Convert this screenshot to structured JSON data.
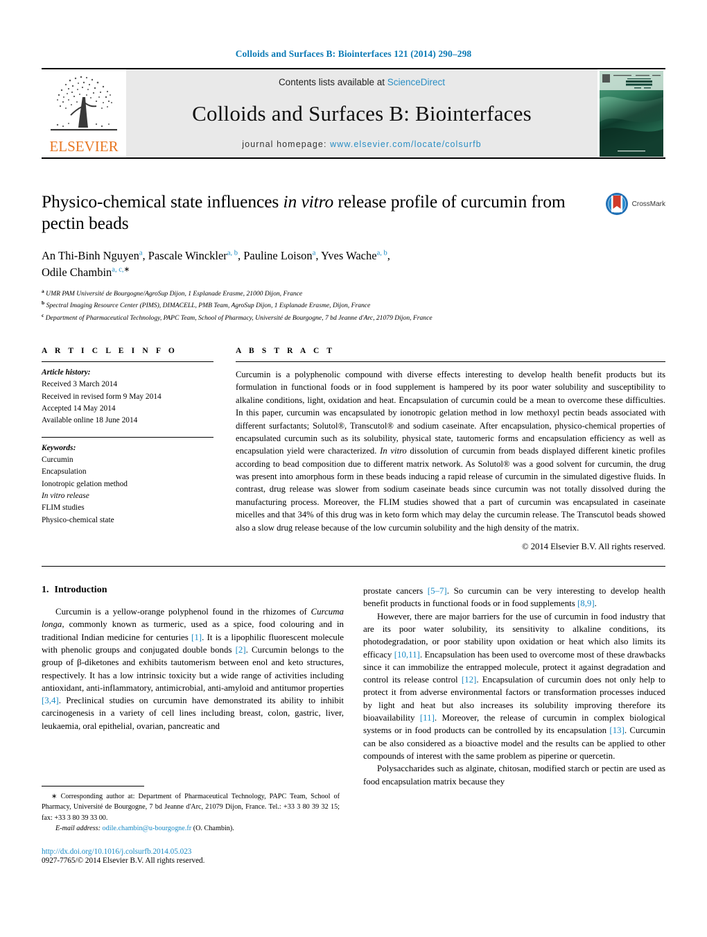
{
  "running_head": "Colloids and Surfaces B: Biointerfaces 121 (2014) 290–298",
  "masthead": {
    "contents_prefix": "Contents lists available at ",
    "sciencedirect": "ScienceDirect",
    "journal_title": "Colloids and Surfaces B: Biointerfaces",
    "homepage_label": "journal homepage: ",
    "homepage_url": "www.elsevier.com/locate/colsurfb",
    "publisher_wordmark": "ELSEVIER",
    "publisher_color": "#E87722",
    "cover_alt": "journal-cover-thumbnail"
  },
  "article": {
    "title_part1": "Physico-chemical state influences ",
    "title_italic": "in vitro",
    "title_part2": " release profile of curcumin from pectin beads",
    "crossmark_label": "CrossMark",
    "authors": [
      {
        "name": "An Thi-Binh Nguyen",
        "sup": "a",
        "sep": ", "
      },
      {
        "name": "Pascale Winckler",
        "sup": "a, b",
        "sep": ", "
      },
      {
        "name": "Pauline Loison",
        "sup": "a",
        "sep": ", "
      },
      {
        "name": "Yves Wache",
        "sup": "a, b",
        "sep": ", "
      },
      {
        "name": "Odile Chambin",
        "sup": "a, c,",
        "sep": ""
      }
    ],
    "affiliations": [
      {
        "mark": "a",
        "text": "UMR PAM Université de Bourgogne/AgroSup Dijon, 1 Esplanade Erasme, 21000 Dijon, France"
      },
      {
        "mark": "b",
        "text": "Spectral Imaging Resource Center (PIMS), DIMACELL, PMB Team, AgroSup Dijon, 1 Esplanade Erasme, Dijon, France"
      },
      {
        "mark": "c",
        "text": "Department of Pharmaceutical Technology, PAPC Team, School of Pharmacy, Université de Bourgogne, 7 bd Jeanne d'Arc, 21079 Dijon, France"
      }
    ]
  },
  "article_info": {
    "heading": "A R T I C L E    I N F O",
    "history_label": "Article history:",
    "history": [
      "Received 3 March 2014",
      "Received in revised form 9 May 2014",
      "Accepted 14 May 2014",
      "Available online 18 June 2014"
    ],
    "keywords_label": "Keywords:",
    "keywords": [
      "Curcumin",
      "Encapsulation",
      "Ionotropic gelation method",
      "In vitro release",
      "FLIM studies",
      "Physico-chemical state"
    ],
    "keyword_italic_index": 3
  },
  "abstract": {
    "heading": "A B S T R A C T",
    "p1": "Curcumin is a polyphenolic compound with diverse effects interesting to develop health benefit products but its formulation in functional foods or in food supplement is hampered by its poor water solubility and susceptibility to alkaline conditions, light, oxidation and heat. Encapsulation of curcumin could be a mean to overcome these difficulties. In this paper, curcumin was encapsulated by ionotropic gelation method in low methoxyl pectin beads associated with different surfactants; Solutol®, Transcutol® and sodium caseinate. After encapsulation, physico-chemical properties of encapsulated curcumin such as its solubility, physical state, tautomeric forms and encapsulation efficiency as well as encapsulation yield were characterized. ",
    "p2_italic": "In vitro",
    "p3": " dissolution of curcumin from beads displayed different kinetic profiles according to bead composition due to different matrix network. As Solutol® was a good solvent for curcumin, the drug was present into amorphous form in these beads inducing a rapid release of curcumin in the simulated digestive fluids. In contrast, drug release was slower from sodium caseinate beads since curcumin was not totally dissolved during the manufacturing process. Moreover, the FLIM studies showed that a part of curcumin was encapsulated in caseinate micelles and that 34% of this drug was in keto form which may delay the curcumin release. The Transcutol beads showed also a slow drug release because of the low curcumin solubility and the high density of the matrix.",
    "copyright": "© 2014 Elsevier B.V. All rights reserved."
  },
  "body": {
    "section_number": "1.",
    "section_title": "Introduction",
    "left_paragraphs": [
      "Curcumin is a yellow-orange polyphenol found in the rhizomes of Curcuma longa, commonly known as turmeric, used as a spice, food colouring and in traditional Indian medicine for centuries [1]. It is a lipophilic fluorescent molecule with phenolic groups and conjugated double bonds [2]. Curcumin belongs to the group of β-diketones and exhibits tautomerism between enol and keto structures, respectively. It has a low intrinsic toxicity but a wide range of activities including antioxidant, anti-inflammatory, antimicrobial, anti-amyloid and antitumor properties [3,4]. Preclinical studies on curcumin have demonstrated its ability to inhibit carcinogenesis in a variety of cell lines including breast, colon, gastric, liver, leukaemia, oral epithelial, ovarian, pancreatic and"
    ],
    "right_paragraphs": [
      "prostate cancers [5–7]. So curcumin can be very interesting to develop health benefit products in functional foods or in food supplements [8,9].",
      "However, there are major barriers for the use of curcumin in food industry that are its poor water solubility, its sensitivity to alkaline conditions, its photodegradation, or poor stability upon oxidation or heat which also limits its efficacy [10,11]. Encapsulation has been used to overcome most of these drawbacks since it can immobilize the entrapped molecule, protect it against degradation and control its release control [12]. Encapsulation of curcumin does not only help to protect it from adverse environmental factors or transformation processes induced by light and heat but also increases its solubility improving therefore its bioavailability [11]. Moreover, the release of curcumin in complex biological systems or in food products can be controlled by its encapsulation [13]. Curcumin can be also considered as a bioactive model and the results can be applied to other compounds of interest with the same problem as piperine or quercetin.",
      "Polysaccharides such as alginate, chitosan, modified starch or pectin are used as food encapsulation matrix because they"
    ]
  },
  "footnotes": {
    "corresponding": "Corresponding author at: Department of Pharmaceutical Technology, PAPC Team, School of Pharmacy, Université de Bourgogne, 7 bd Jeanne d'Arc, 21079 Dijon, France. Tel.: +33 3 80 39 32 15; fax: +33 3 80 39 33 00.",
    "email_label": "E-mail address:",
    "email": "odile.chambin@u-bourgogne.fr",
    "email_owner": "(O. Chambin).",
    "doi": "http://dx.doi.org/10.1016/j.colsurfb.2014.05.023",
    "issn_line": "0927-7765/© 2014 Elsevier B.V. All rights reserved."
  },
  "colors": {
    "link": "#1a8ac4",
    "runhead": "#0b7ab5",
    "elsevier_orange": "#E87722",
    "masthead_bg": "#e9e9e9"
  }
}
